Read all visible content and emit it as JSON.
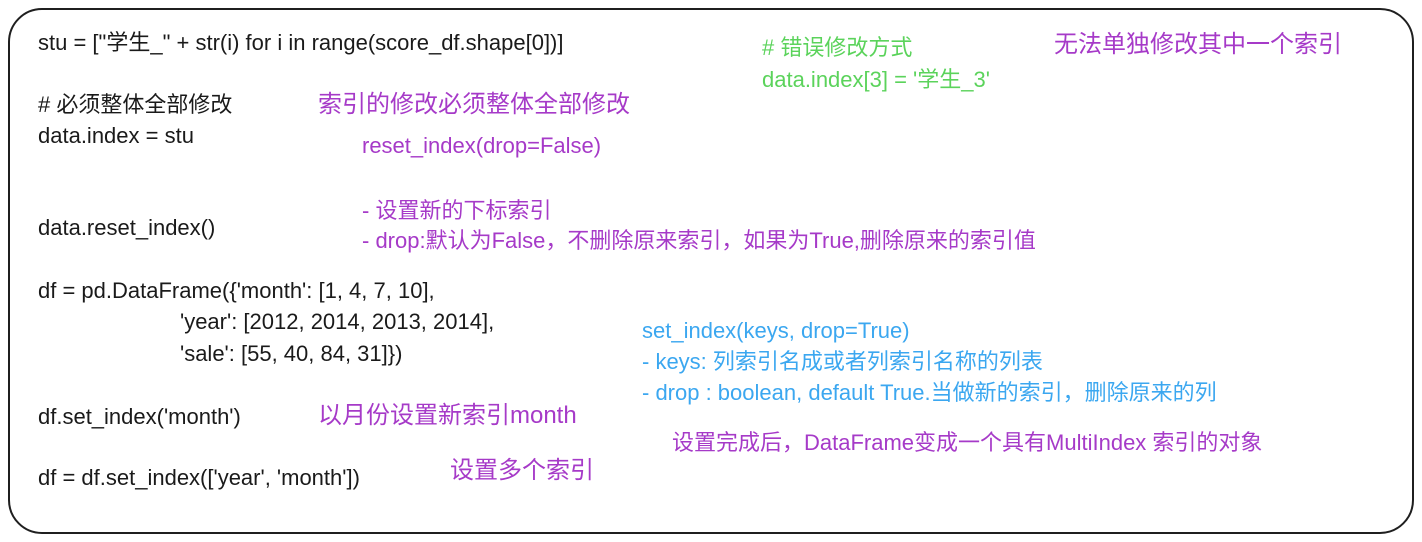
{
  "code": {
    "stu_line": "stu = [\"学生_\" + str(i) for i in range(score_df.shape[0])]",
    "comment_must_whole": "# 必须整体全部修改",
    "data_index": "data.index = stu",
    "reset_index_call": "data.reset_index()",
    "df_line1": "df = pd.DataFrame({'month': [1, 4, 7, 10],",
    "df_line2": "'year': [2012, 2014, 2013, 2014],",
    "df_line3": "'sale': [55, 40, 84, 31]})",
    "set_index_month": "df.set_index('month')",
    "set_index_multi": "df = df.set_index(['year', 'month'])"
  },
  "notes": {
    "wrong_comment": "# 错误修改方式",
    "wrong_code": "data.index[3] = '学生_3'",
    "cannot_single": "无法单独修改其中一个索引",
    "must_whole": "索引的修改必须整体全部修改",
    "reset_sig": "reset_index(drop=False)",
    "reset_desc1": "- 设置新的下标索引",
    "reset_desc2": "- drop:默认为False，不删除原来索引，如果为True,删除原来的索引值",
    "set_sig": "set_index(keys, drop=True)",
    "set_keys": "- keys: 列索引名成或者列索引名称的列表",
    "set_drop": "- drop : boolean, default True.当做新的索引，删除原来的列",
    "month_note": "以月份设置新索引month",
    "multi_result": "设置完成后，DataFrame变成一个具有MultiIndex 索引的对象",
    "multi_note": "设置多个索引"
  },
  "colors": {
    "code": "#1a1a1a",
    "annotation": "#a63ac8",
    "wrong_example": "#5bd35b",
    "api_doc": "#3ba7f0",
    "border": "#1f1f1f"
  }
}
